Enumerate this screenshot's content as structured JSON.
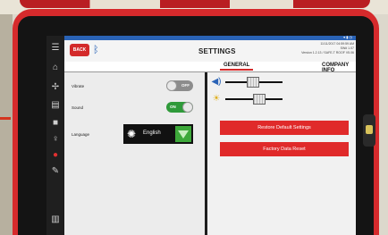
{
  "header": {
    "back_label": "BACK",
    "title": "SETTINGS",
    "info_lines": [
      "11/11/2017 04:59:59 AM",
      "SW# 1.07",
      "Version 1.2.13 / SAFE-T ROOF V5.06"
    ]
  },
  "tabs": [
    {
      "label": "GENERAL",
      "active": true
    },
    {
      "label": "COMPANY INFO",
      "active": false
    }
  ],
  "general": {
    "vibrate": {
      "label": "Vibrate",
      "state": "OFF"
    },
    "sound": {
      "label": "Sound",
      "state": "ON"
    },
    "language": {
      "label": "Language",
      "value": "English"
    }
  },
  "sliders": {
    "volume_level": 0.48,
    "brightness_level": 0.62
  },
  "buttons": {
    "restore": "Restore Default Settings",
    "factory_reset": "Factory Data Reset"
  },
  "colors": {
    "accent_red": "#e02a2a",
    "toggle_on": "#2f9a3a",
    "status_blue": "#2a63b6"
  },
  "icons": [
    "bluetooth-icon",
    "speaker-icon",
    "brightness-icon",
    "globe-icon",
    "dropdown-arrow-icon"
  ]
}
